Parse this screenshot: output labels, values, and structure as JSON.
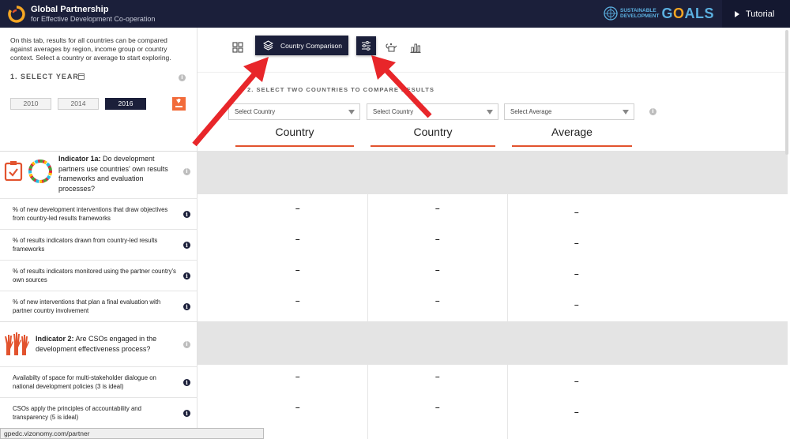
{
  "header": {
    "brand_title": "Global Partnership",
    "brand_subtitle": "for Effective Development Co-operation",
    "sdg_line1": "SUSTAINABLE",
    "sdg_line2": "DEVELOPMENT",
    "sdg_goals_g": "G",
    "sdg_goals_o": "O",
    "sdg_goals_rest": "ALS",
    "tutorial_label": "Tutorial"
  },
  "sidebar": {
    "intro": "On this tab, results for all countries can be compared against averages by region, income group or country context. Select a country or average to start exploring.",
    "year_heading": "1. SELECT YEAR",
    "years": [
      "2010",
      "2014",
      "2016"
    ],
    "selected_year": "2016",
    "indicator_1a": {
      "bold": "Indicator 1a:",
      "text": " Do development partners use countries' own results frameworks and evaluation processes?",
      "metrics": [
        "% of new development interventions that draw objectives from country-led results frameworks",
        "% of results indicators drawn from country-led results frameworks",
        "% of results indicators monitored using the partner country's own sources",
        "% of new interventions that plan a final evaluation with partner country involvement"
      ]
    },
    "indicator_2": {
      "bold": "Indicator 2:",
      "text": " Are CSOs engaged in the development effectiveness process?",
      "metrics": [
        "Availabilty of space for multi-stakeholder dialogue on national development policies (3 is ideal)",
        "CSOs apply the principles of accountability and transparency (5 is ideal)"
      ]
    }
  },
  "toolbar": {
    "country_comparison_label": "Country Comparison"
  },
  "compare": {
    "heading": "2. SELECT TWO COUNTRIES TO COMPARE RESULTS",
    "select_1_placeholder": "Select Country",
    "select_2_placeholder": "Select Country",
    "select_3_placeholder": "Select Average",
    "col_1": "Country",
    "col_2": "Country",
    "col_3": "Average",
    "empty_value": "–"
  },
  "status_bar": {
    "url": "gpedc.vizonomy.com/partner"
  },
  "colors": {
    "navy": "#1b1f3a",
    "accent": "#e2532e",
    "arrow": "#e8262a"
  }
}
